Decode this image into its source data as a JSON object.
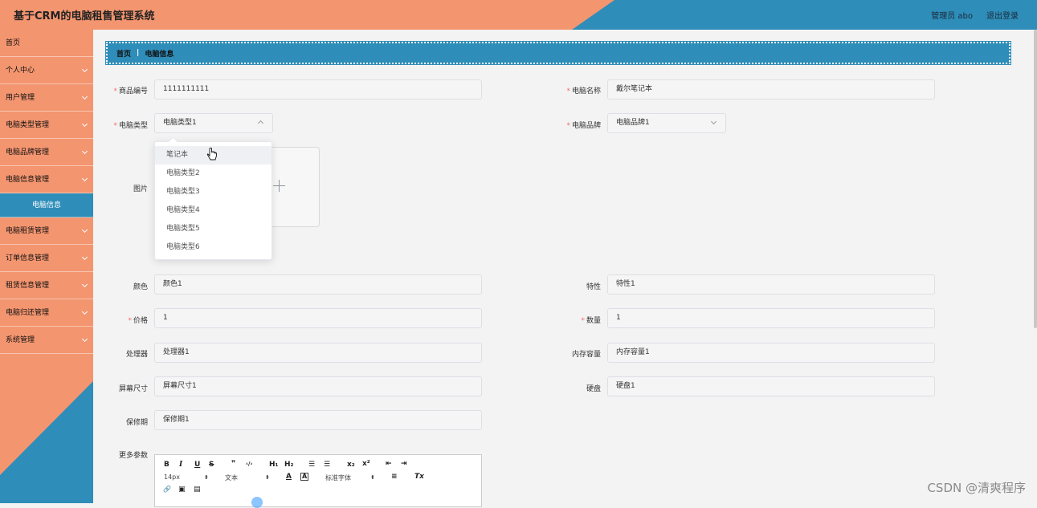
{
  "header": {
    "title": "基于CRM的电脑租售管理系统",
    "admin": "管理员 abo",
    "logout": "退出登录"
  },
  "sidebar": {
    "items": [
      {
        "label": "首页",
        "chevron": false
      },
      {
        "label": "个人中心",
        "chevron": true
      },
      {
        "label": "用户管理",
        "chevron": true
      },
      {
        "label": "电脑类型管理",
        "chevron": true
      },
      {
        "label": "电脑品牌管理",
        "chevron": true
      },
      {
        "label": "电脑信息管理",
        "chevron": true
      }
    ],
    "active_sub": "电脑信息",
    "items2": [
      {
        "label": "电脑租赁管理",
        "chevron": true
      },
      {
        "label": "订单信息管理",
        "chevron": true
      },
      {
        "label": "租赁信息管理",
        "chevron": true
      },
      {
        "label": "电脑归还管理",
        "chevron": true
      },
      {
        "label": "系统管理",
        "chevron": true
      }
    ]
  },
  "breadcrumb": {
    "home": "首页",
    "current": "电脑信息"
  },
  "form": {
    "code_label": "商品编号",
    "code_value": "1111111111",
    "name_label": "电脑名称",
    "name_value": "戴尔笔记本",
    "type_label": "电脑类型",
    "type_value": "电脑类型1",
    "brand_label": "电脑品牌",
    "brand_value": "电脑品牌1",
    "image_label": "图片",
    "color_label": "颜色",
    "color_value": "颜色1",
    "feature_label": "特性",
    "feature_value": "特性1",
    "price_label": "价格",
    "price_value": "1",
    "qty_label": "数量",
    "qty_value": "1",
    "cpu_label": "处理器",
    "cpu_value": "处理器1",
    "mem_label": "内存容量",
    "mem_value": "内存容量1",
    "screen_label": "屏幕尺寸",
    "screen_value": "屏幕尺寸1",
    "disk_label": "硬盘",
    "disk_value": "硬盘1",
    "warranty_label": "保修期",
    "warranty_value": "保修期1",
    "more_label": "更多参数"
  },
  "dropdown": {
    "options": [
      "笔记本",
      "电脑类型2",
      "电脑类型3",
      "电脑类型4",
      "电脑类型5",
      "电脑类型6"
    ]
  },
  "editor": {
    "bold": "B",
    "italic": "I",
    "underline": "U",
    "strike": "S",
    "quote": "❞",
    "code": "‹/›",
    "h1": "H₁",
    "h2": "H₂",
    "ol": "☰",
    "ul": "☰",
    "sub": "x₂",
    "sup": "x²",
    "outdent": "⇤",
    "indent": "⇥",
    "size": "14px",
    "text": "文本",
    "font_color": "A",
    "bg_color": "A",
    "font": "标准字体",
    "align": "≡",
    "clear": "Tx",
    "link": "🔗",
    "image": "▣",
    "video": "▤"
  },
  "watermark": "CSDN @清爽程序"
}
